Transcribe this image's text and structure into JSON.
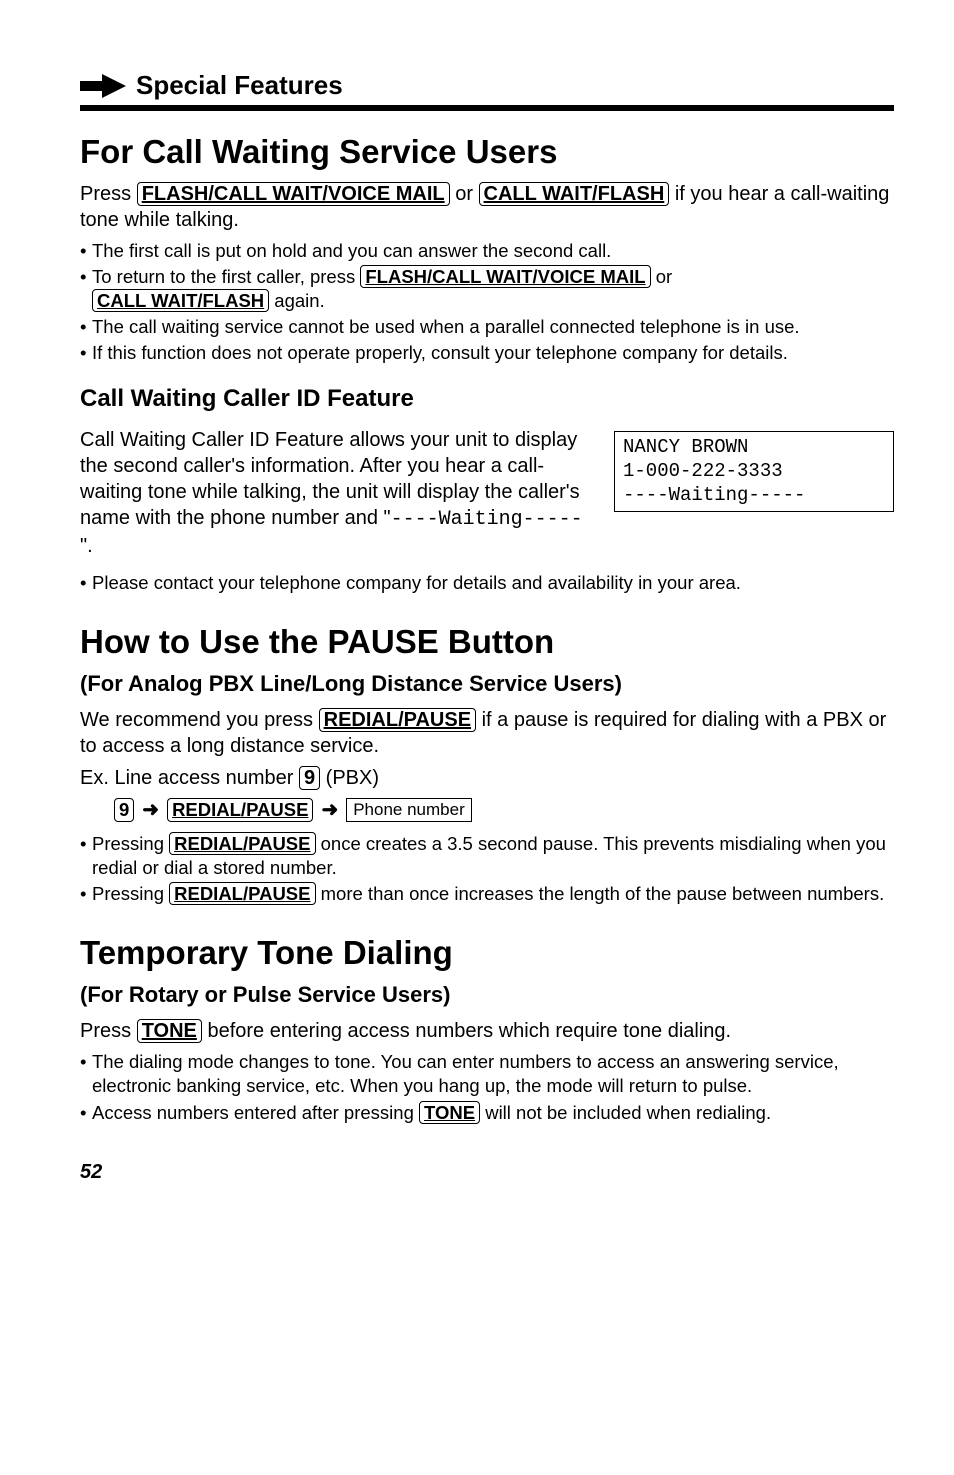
{
  "header": {
    "title": "Special Features"
  },
  "section1": {
    "title": "For Call Waiting Service Users",
    "intro_pre": "Press ",
    "key1": "FLASH/CALL WAIT/VOICE MAIL",
    "intro_or": " or ",
    "key2": "CALL WAIT/FLASH",
    "intro_post": " if you hear a call-waiting tone while talking.",
    "bullets": {
      "b1": "The first call is put on hold and you can answer the second call.",
      "b2_pre": "To return to the first caller, press ",
      "b2_key1": "FLASH/CALL WAIT/VOICE MAIL",
      "b2_or": " or ",
      "b2_key2": "CALL WAIT/FLASH",
      "b2_post": " again.",
      "b3": "The call waiting service cannot be used when a parallel connected telephone is in use.",
      "b4": "If this function does not operate properly, consult your telephone company for details."
    },
    "sub": {
      "title": "Call Waiting Caller ID Feature",
      "para_pre": "Call Waiting Caller ID Feature allows your unit to display the second caller's information. After you hear a call-waiting tone while talking, the unit will display the caller's name with the phone number and \"",
      "para_mono": "----Waiting-----",
      "para_post": "\".",
      "display_l1": "NANCY BROWN",
      "display_l2": "1-000-222-3333",
      "display_l3": "----Waiting-----",
      "bullet": "Please contact your telephone company for details and availability in your area."
    }
  },
  "section2": {
    "title": "How to Use the PAUSE Button",
    "subtitle": "(For Analog PBX Line/Long Distance Service Users)",
    "para_pre": "We recommend you press ",
    "para_key": "REDIAL/PAUSE",
    "para_post": " if a pause is required for dialing with a PBX or to access a long distance service.",
    "ex_pre": "Ex.  Line access number ",
    "ex_key": "9",
    "ex_post": " (PBX)",
    "seq": {
      "k1": "9",
      "k2": "REDIAL/PAUSE",
      "box": "Phone number"
    },
    "bullets": {
      "b1_pre": "Pressing ",
      "b1_key": "REDIAL/PAUSE",
      "b1_post": " once creates a 3.5 second pause. This prevents misdialing when you redial or dial a stored number.",
      "b2_pre": "Pressing ",
      "b2_key": "REDIAL/PAUSE",
      "b2_post": " more than once increases the length of the pause between numbers."
    }
  },
  "section3": {
    "title": "Temporary Tone Dialing",
    "subtitle": "(For Rotary or Pulse Service Users)",
    "para_pre": "Press ",
    "para_key": "TONE",
    "para_post": " before entering access numbers which require tone dialing.",
    "bullets": {
      "b1": "The dialing mode changes to tone. You can enter numbers to access an answering service, electronic banking service, etc. When you hang up, the mode will return to pulse.",
      "b2_pre": "Access numbers entered after pressing ",
      "b2_key": "TONE",
      "b2_post": " will not be included when redialing."
    }
  },
  "page_number": "52"
}
